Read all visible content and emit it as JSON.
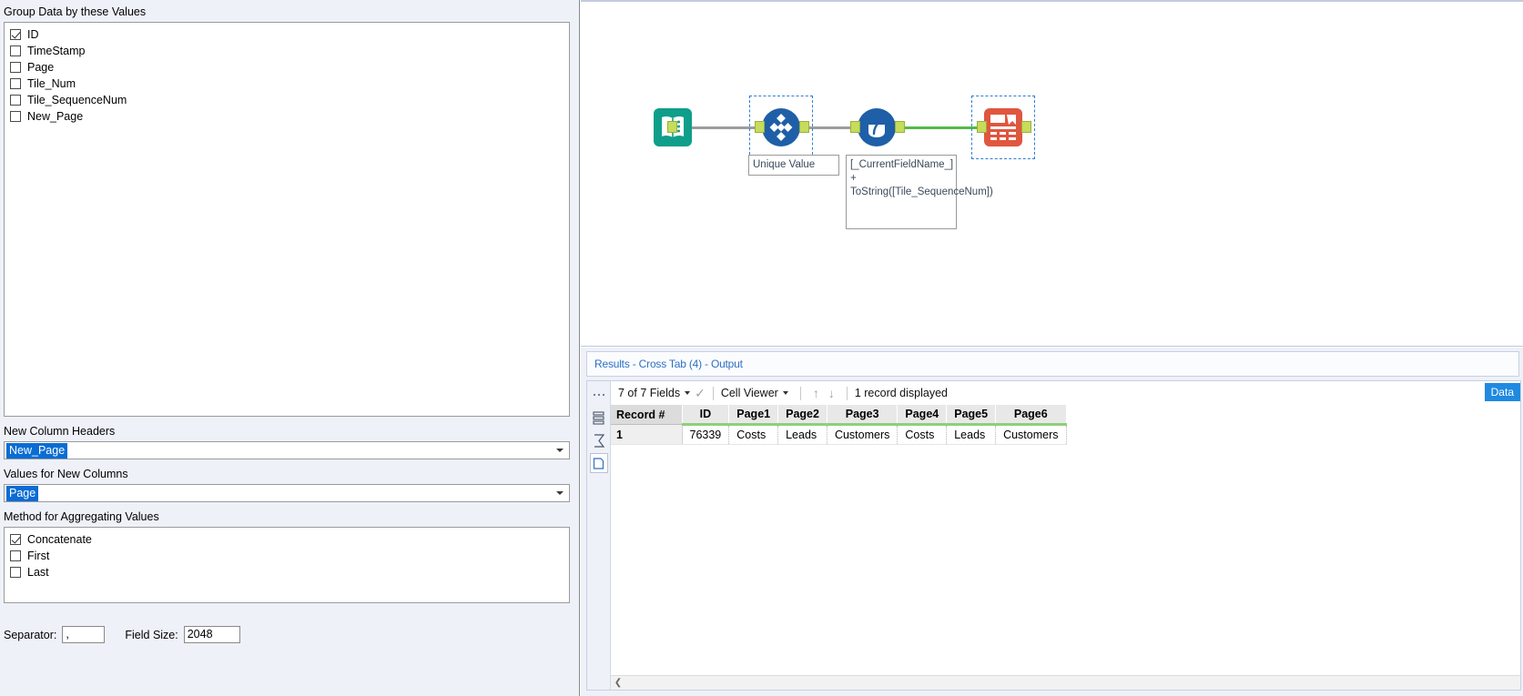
{
  "config_panel": {
    "group_section_label": "Group Data by these Values",
    "group_fields": [
      {
        "label": "ID",
        "checked": true
      },
      {
        "label": "TimeStamp",
        "checked": false
      },
      {
        "label": "Page",
        "checked": false
      },
      {
        "label": "Tile_Num",
        "checked": false
      },
      {
        "label": "Tile_SequenceNum",
        "checked": false
      },
      {
        "label": "New_Page",
        "checked": false
      }
    ],
    "new_column_headers_label": "New Column Headers",
    "new_column_headers_value": "New_Page",
    "values_for_new_columns_label": "Values for New Columns",
    "values_for_new_columns_value": "Page",
    "method_section_label": "Method for Aggregating Values",
    "method_options": [
      {
        "label": "Concatenate",
        "checked": true
      },
      {
        "label": "First",
        "checked": false
      },
      {
        "label": "Last",
        "checked": false
      }
    ],
    "separator_label": "Separator:",
    "separator_value": ",",
    "field_size_label": "Field Size:",
    "field_size_value": "2048"
  },
  "canvas": {
    "nodes": [
      {
        "name": "input-data-tool",
        "selected": false
      },
      {
        "name": "unique-tool",
        "selected": true
      },
      {
        "name": "formula-tool",
        "selected": false
      },
      {
        "name": "cross-tab-tool",
        "selected": true
      }
    ],
    "annotations": [
      {
        "name": "unique-value-annotation",
        "text": "Unique Value"
      },
      {
        "name": "formula-annotation",
        "text": "[_CurrentFieldName_] + ToString([Tile_SequenceNum])"
      }
    ]
  },
  "results": {
    "title": "Results - Cross Tab (4) - Output",
    "toolbar": {
      "fields_label": "7 of 7 Fields",
      "viewer_label": "Cell Viewer",
      "record_count_label": "1 record displayed",
      "data_badge": "Data"
    },
    "columns": [
      "Record #",
      "ID",
      "Page1",
      "Page2",
      "Page3",
      "Page4",
      "Page5",
      "Page6"
    ],
    "rows": [
      [
        "1",
        "76339",
        "Costs",
        "Leads",
        "Customers",
        "Costs",
        "Leads",
        "Customers"
      ]
    ]
  },
  "colors": {
    "panel_bg": "#eef1f8",
    "selection_blue": "#0a6cd4",
    "header_green": "#8dd07a",
    "accent_blue": "#1f8ae0",
    "link_blue": "#2e6fc4",
    "input_tool_teal": "#0f9e8a",
    "tool_blue": "#1f5fa8",
    "crosstab_red": "#e0563f",
    "connector_grey": "#9d9d9d",
    "connector_green": "#54b948"
  }
}
